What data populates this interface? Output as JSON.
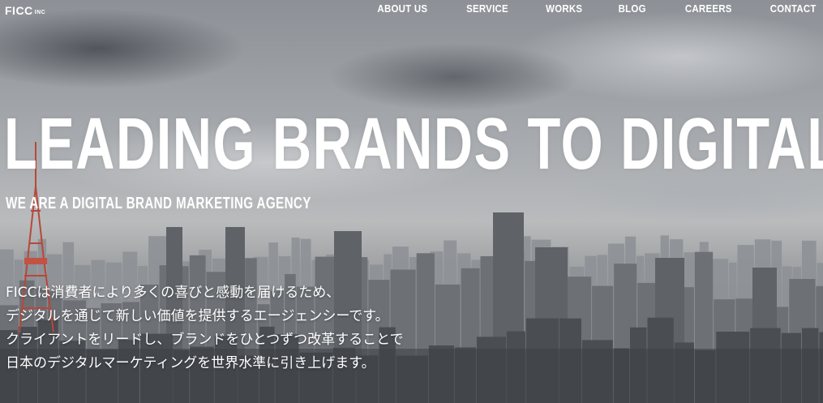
{
  "brand": {
    "logo": "FICC",
    "logo_suffix": "INC"
  },
  "nav": {
    "items": [
      {
        "label": "ABOUT US"
      },
      {
        "label": "SERVICE"
      },
      {
        "label": "WORKS"
      },
      {
        "label": "BLOG"
      },
      {
        "label": "CAREERS"
      },
      {
        "label": "CONTACT"
      }
    ]
  },
  "hero": {
    "headline": "LEADING BRANDS TO DIGITAL",
    "subheadline": "WE ARE A DIGITAL BRAND MARKETING AGENCY",
    "intro_lines": [
      "FICCは消費者により多くの喜びと感動を届けるため、",
      "デジタルを通じて新しい価値を提供するエージェンシーです。",
      "クライアントをリードし、ブランドをひとつずつ改革することで",
      "日本のデジタルマーケティングを世界水準に引き上げます。"
    ]
  },
  "colors": {
    "text": "#ffffff",
    "tower": "#c0392b"
  }
}
